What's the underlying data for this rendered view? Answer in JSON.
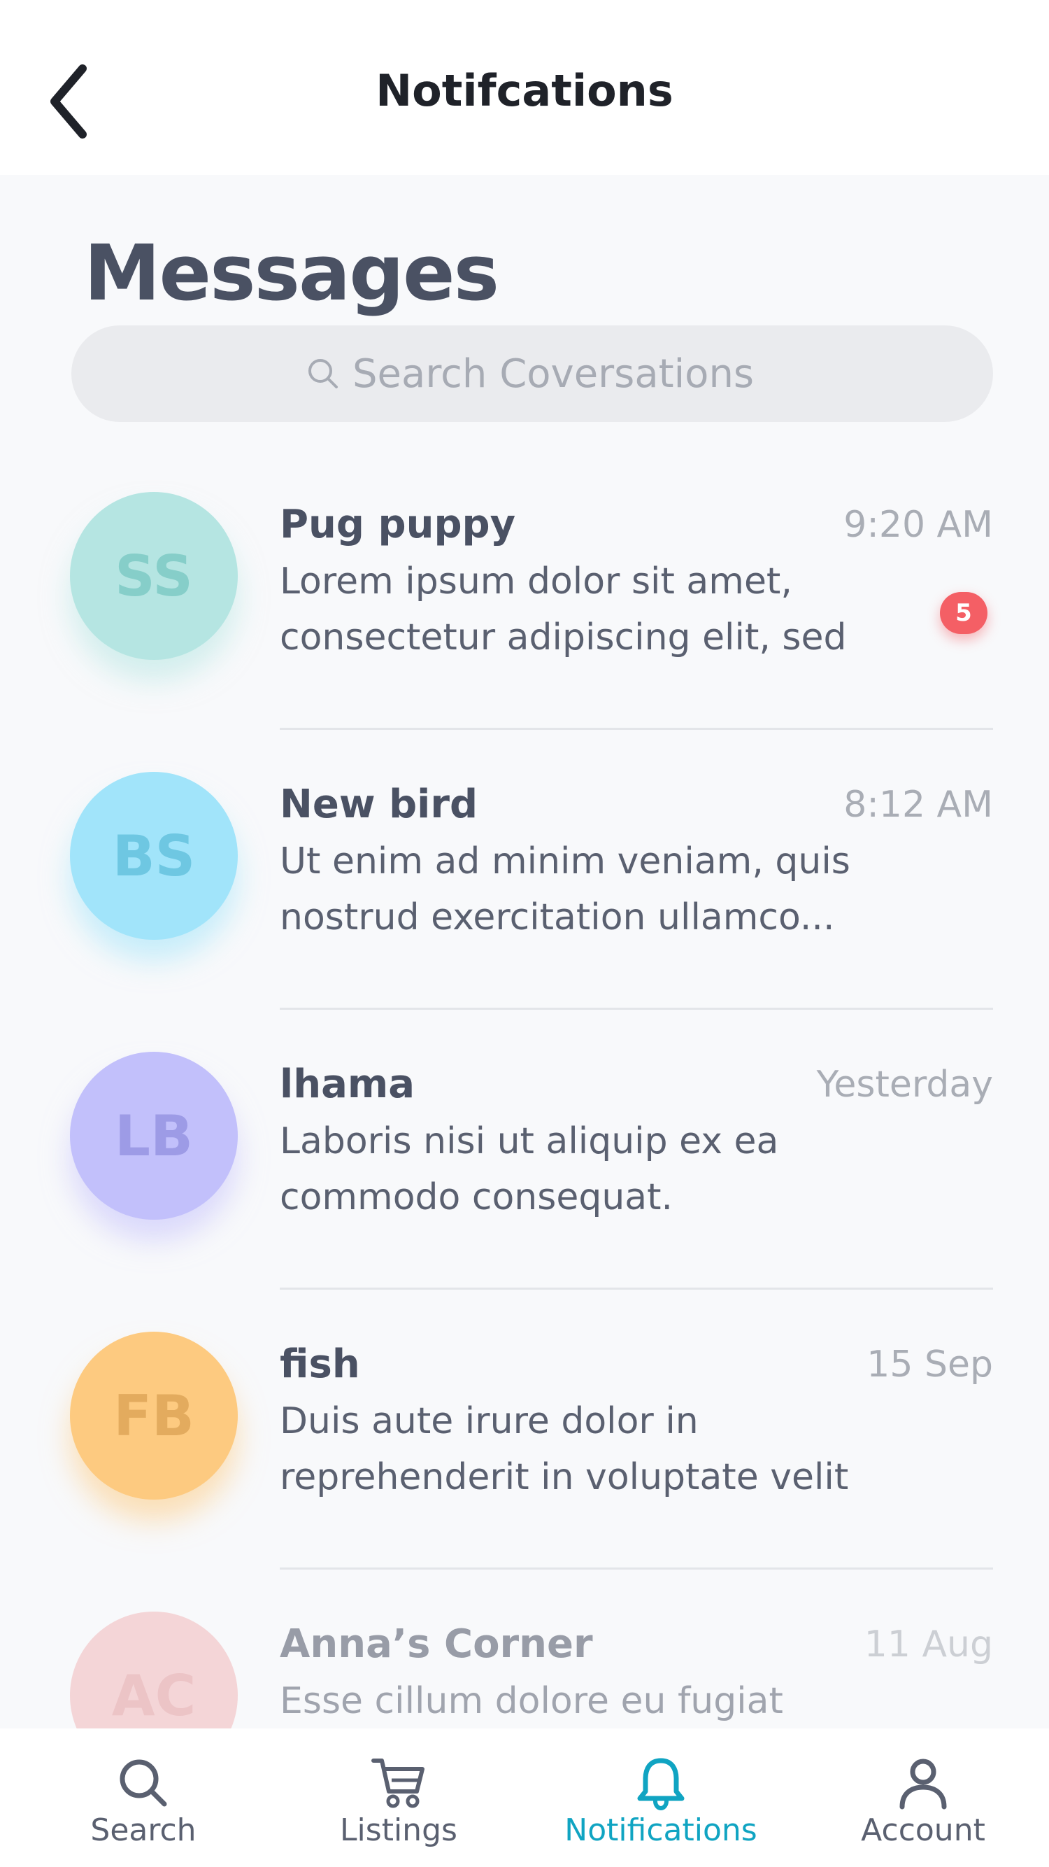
{
  "header": {
    "title": "Notifcations"
  },
  "section": {
    "title": "Messages"
  },
  "search": {
    "placeholder": "Search Coversations"
  },
  "conversations": [
    {
      "initials": "SS",
      "name": "Pug puppy",
      "time": "9:20 AM",
      "preview_line1": "Lorem ipsum dolor sit amet,",
      "preview_line2": "consectetur adipiscing elit, sed",
      "badge": "5",
      "avatar_color": "#b5e5e2",
      "initials_color": "#86cec9"
    },
    {
      "initials": "BS",
      "name": "New bird",
      "time": "8:12 AM",
      "preview_line1": "Ut enim ad minim veniam, quis",
      "preview_line2": "nostrud exercitation ullamco...",
      "avatar_color": "#a1e4fa",
      "initials_color": "#6ec7e2"
    },
    {
      "initials": "LB",
      "name": "lhama",
      "time": "Yesterday",
      "preview_line1": "Laboris nisi ut aliquip ex ea",
      "preview_line2": "commodo consequat.",
      "avatar_color": "#c2c0fb",
      "initials_color": "#9d9be6"
    },
    {
      "initials": "FB",
      "name": "fish",
      "time": "15 Sep",
      "preview_line1": "Duis aute irure dolor in",
      "preview_line2": "reprehenderit in voluptate velit",
      "avatar_color": "#fdca80",
      "initials_color": "#e3ab5e"
    },
    {
      "initials": "AC",
      "name": "Anna’s Corner",
      "time": "11 Aug",
      "preview_line1": "Esse cillum dolore eu fugiat",
      "preview_line2": "",
      "avatar_color": "#f2b9bb",
      "initials_color": "#e3999c"
    }
  ],
  "nav": {
    "items": [
      {
        "label": "Search",
        "icon": "search-icon"
      },
      {
        "label": "Listings",
        "icon": "cart-icon"
      },
      {
        "label": "Notifications",
        "icon": "bell-icon"
      },
      {
        "label": "Account",
        "icon": "account-icon"
      }
    ],
    "active": "Notifications",
    "active_color": "#10a4c2"
  }
}
